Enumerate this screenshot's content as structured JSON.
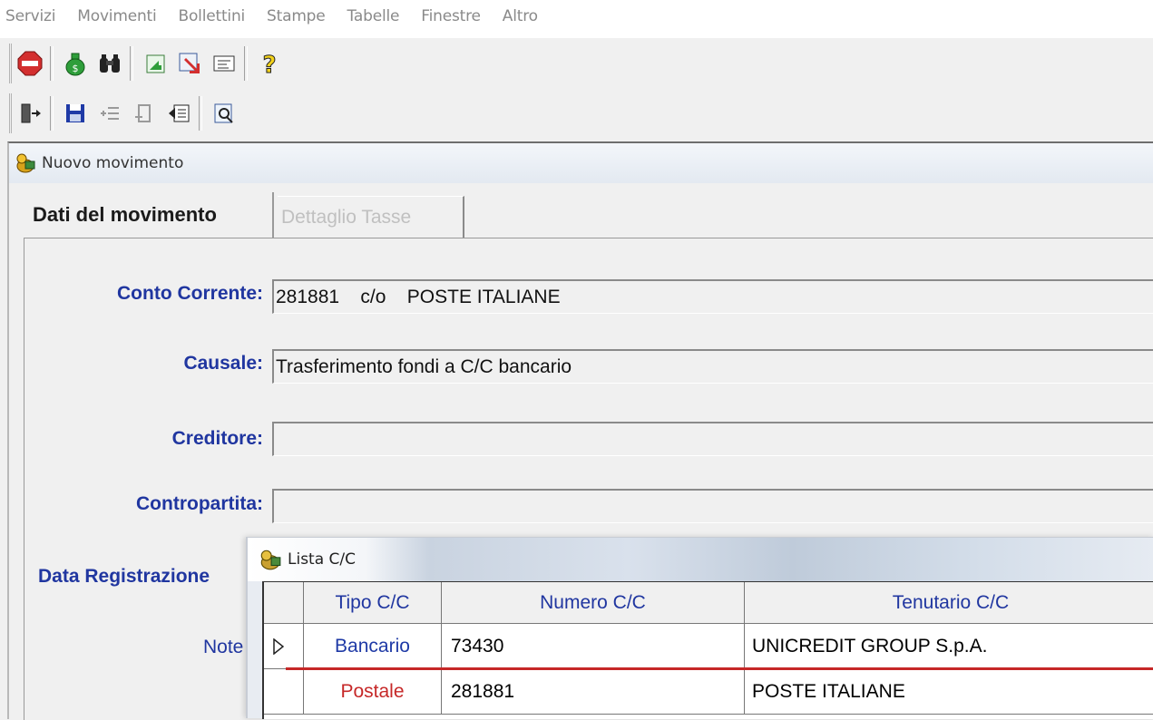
{
  "menu": [
    "Servizi",
    "Movimenti",
    "Bollettini",
    "Stampe",
    "Tabelle",
    "Finestre",
    "Altro"
  ],
  "toolbar1_icons": [
    "stop-icon",
    "money-bag-icon",
    "binoculars-icon",
    "green-arrow-icon",
    "red-arrow-icon",
    "form-icon",
    "help-icon"
  ],
  "toolbar2_icons": [
    "exit-door-icon",
    "save-icon",
    "insert-row-icon",
    "delete-row-icon",
    "undo-icon",
    "search-doc-icon"
  ],
  "window": {
    "title": "Nuovo movimento",
    "tabs": [
      "Dati del movimento",
      "Dettaglio Tasse"
    ]
  },
  "form": {
    "conto_label": "Conto Corrente:",
    "conto_value": "281881    c/o    POSTE ITALIANE",
    "causale_label": "Causale:",
    "causale_value": "Trasferimento fondi a C/C bancario",
    "creditore_label": "Creditore:",
    "creditore_value": "",
    "contropartita_label": "Contropartita:",
    "contropartita_value": "",
    "data_reg_label": "Data Registrazione",
    "note_label": "Note"
  },
  "popup": {
    "title": "Lista C/C",
    "columns": [
      "Tipo C/C",
      "Numero C/C",
      "Tenutario C/C"
    ],
    "rows": [
      {
        "tipo": "Bancario",
        "numero": "73430",
        "tenutario": "UNICREDIT GROUP  S.p.A.",
        "tipo_color": "#1f3aa6"
      },
      {
        "tipo": "Postale",
        "numero": "281881",
        "tenutario": "POSTE ITALIANE",
        "tipo_color": "#c62828"
      }
    ]
  }
}
